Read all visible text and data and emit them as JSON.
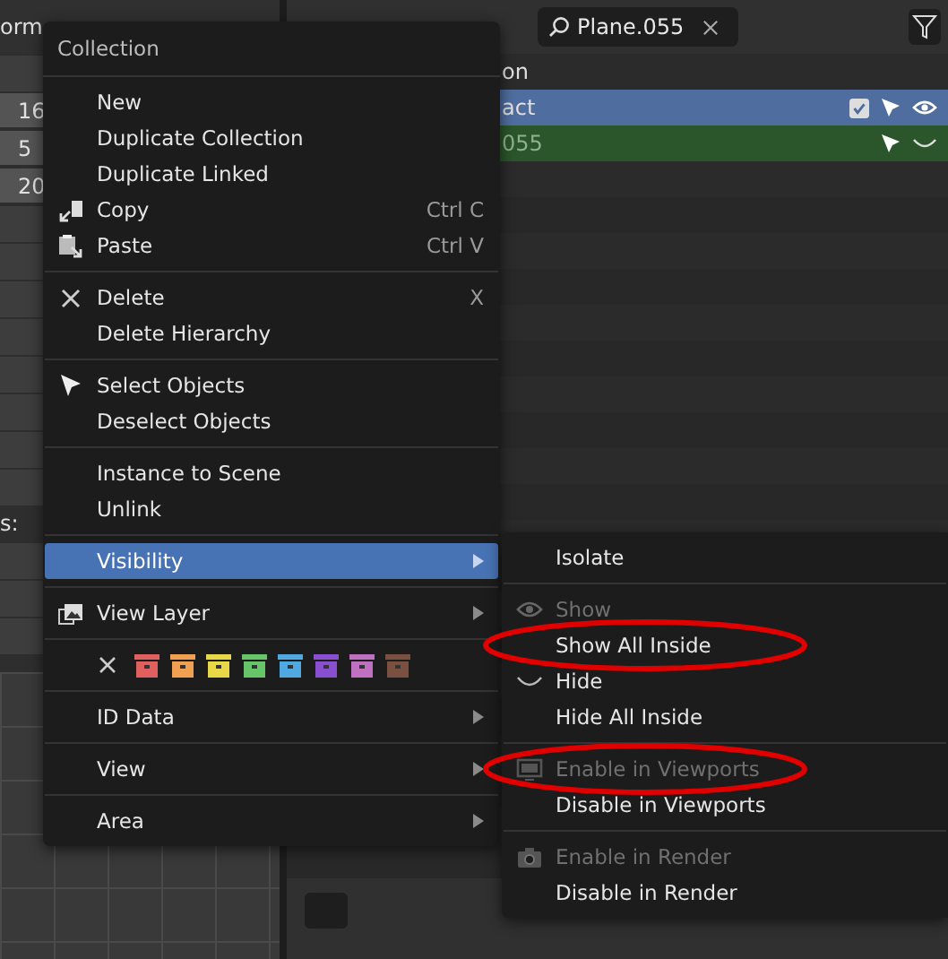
{
  "properties_panel": {
    "header": "orm",
    "fields": [
      "16",
      "5",
      "20"
    ],
    "label": "s:"
  },
  "outliner": {
    "search": {
      "value": "Plane.055"
    },
    "rows": [
      {
        "text": "on",
        "kind": "plain"
      },
      {
        "text": "act",
        "kind": "selected"
      },
      {
        "text": "055",
        "kind": "active"
      }
    ]
  },
  "context_menu": {
    "title": "Collection",
    "groups": [
      [
        {
          "label": "New",
          "submenu": false,
          "selected": false
        },
        {
          "label": "Duplicate Collection",
          "submenu": false,
          "selected": false
        },
        {
          "label": "Duplicate Linked",
          "submenu": false,
          "selected": false
        },
        {
          "label": "Copy",
          "shortcut": "Ctrl C",
          "submenu": false,
          "selected": false
        },
        {
          "label": "Paste",
          "shortcut": "Ctrl V",
          "submenu": false,
          "selected": false
        }
      ],
      [
        {
          "label": "Delete",
          "shortcut": "X",
          "submenu": false,
          "selected": false
        },
        {
          "label": "Delete Hierarchy",
          "submenu": false,
          "selected": false
        }
      ],
      [
        {
          "label": "Select Objects",
          "submenu": false,
          "selected": false
        },
        {
          "label": "Deselect Objects",
          "submenu": false,
          "selected": false
        }
      ],
      [
        {
          "label": "Instance to Scene",
          "submenu": false,
          "selected": false
        },
        {
          "label": "Unlink",
          "submenu": false,
          "selected": false
        }
      ],
      [
        {
          "label": "Visibility",
          "submenu": true,
          "selected": true
        }
      ],
      [
        {
          "label": "View Layer",
          "submenu": true,
          "selected": false
        }
      ],
      [
        {
          "kind": "color_tags",
          "tags": [
            {
              "color": "#e06060"
            },
            {
              "color": "#f0a050"
            },
            {
              "color": "#e8d848"
            },
            {
              "color": "#68c468"
            },
            {
              "color": "#50a8e0"
            },
            {
              "color": "#8850d0"
            },
            {
              "color": "#c070c0"
            },
            {
              "color": "#7a5040"
            }
          ]
        }
      ],
      [
        {
          "label": "ID Data",
          "submenu": true,
          "selected": false
        }
      ],
      [
        {
          "label": "View",
          "submenu": true,
          "selected": false
        }
      ],
      [
        {
          "label": "Area",
          "submenu": true,
          "selected": false
        }
      ]
    ]
  },
  "visibility_submenu": {
    "groups": [
      [
        {
          "label": "Isolate",
          "disabled": false,
          "circled": false
        }
      ],
      [
        {
          "label": "Show",
          "disabled": true,
          "circled": false
        },
        {
          "label": "Show All Inside",
          "disabled": false,
          "circled": true
        },
        {
          "label": "Hide",
          "disabled": false,
          "circled": false
        },
        {
          "label": "Hide All Inside",
          "disabled": false,
          "circled": false
        }
      ],
      [
        {
          "label": "Enable in Viewports",
          "disabled": true,
          "circled": true
        },
        {
          "label": "Disable in Viewports",
          "disabled": false,
          "circled": false
        }
      ],
      [
        {
          "label": "Enable in Render",
          "disabled": true,
          "circled": false
        },
        {
          "label": "Disable in Render",
          "disabled": false,
          "circled": false
        }
      ]
    ]
  }
}
